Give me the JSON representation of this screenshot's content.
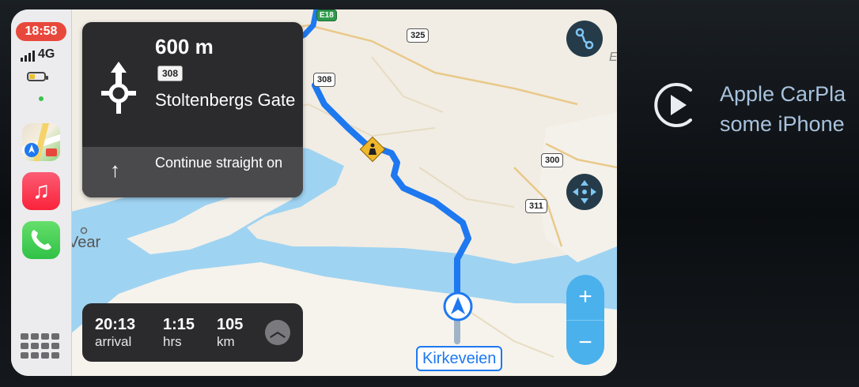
{
  "status": {
    "time": "18:58",
    "network": "4G",
    "battery_level": 0.4
  },
  "sidebar": {
    "apps": [
      {
        "name": "Maps",
        "icon": "maps-icon"
      },
      {
        "name": "Music",
        "icon": "music-note-icon",
        "glyph": "♫"
      },
      {
        "name": "Phone",
        "icon": "phone-icon"
      }
    ]
  },
  "turn": {
    "distance": "600 m",
    "road_number": "308",
    "street": "Stoltenbergs Gate",
    "next_instruction": "Continue straight on",
    "next_arrow": "↑"
  },
  "trip": {
    "arrival_value": "20:13",
    "arrival_label": "arrival",
    "duration_value": "1:15",
    "duration_label": "hrs",
    "distance_value": "105",
    "distance_label": "km"
  },
  "map": {
    "place_label": "Vear",
    "destination_label": "Kirkeveien",
    "road_shields": {
      "e18": "E18",
      "r325": "325",
      "r308": "308",
      "r300": "300",
      "r311": "311"
    },
    "edge_letter": "E"
  },
  "controls": {
    "zoom_in": "+",
    "zoom_out": "−"
  },
  "carplay_notice": {
    "line1": "Apple CarPla",
    "line2": "some iPhone"
  },
  "colors": {
    "route": "#1e78f0",
    "water": "#9fd3f2",
    "land": "#f1ede4",
    "clock_bg": "#e8483c",
    "zoom_bg": "#4ab1ec"
  }
}
